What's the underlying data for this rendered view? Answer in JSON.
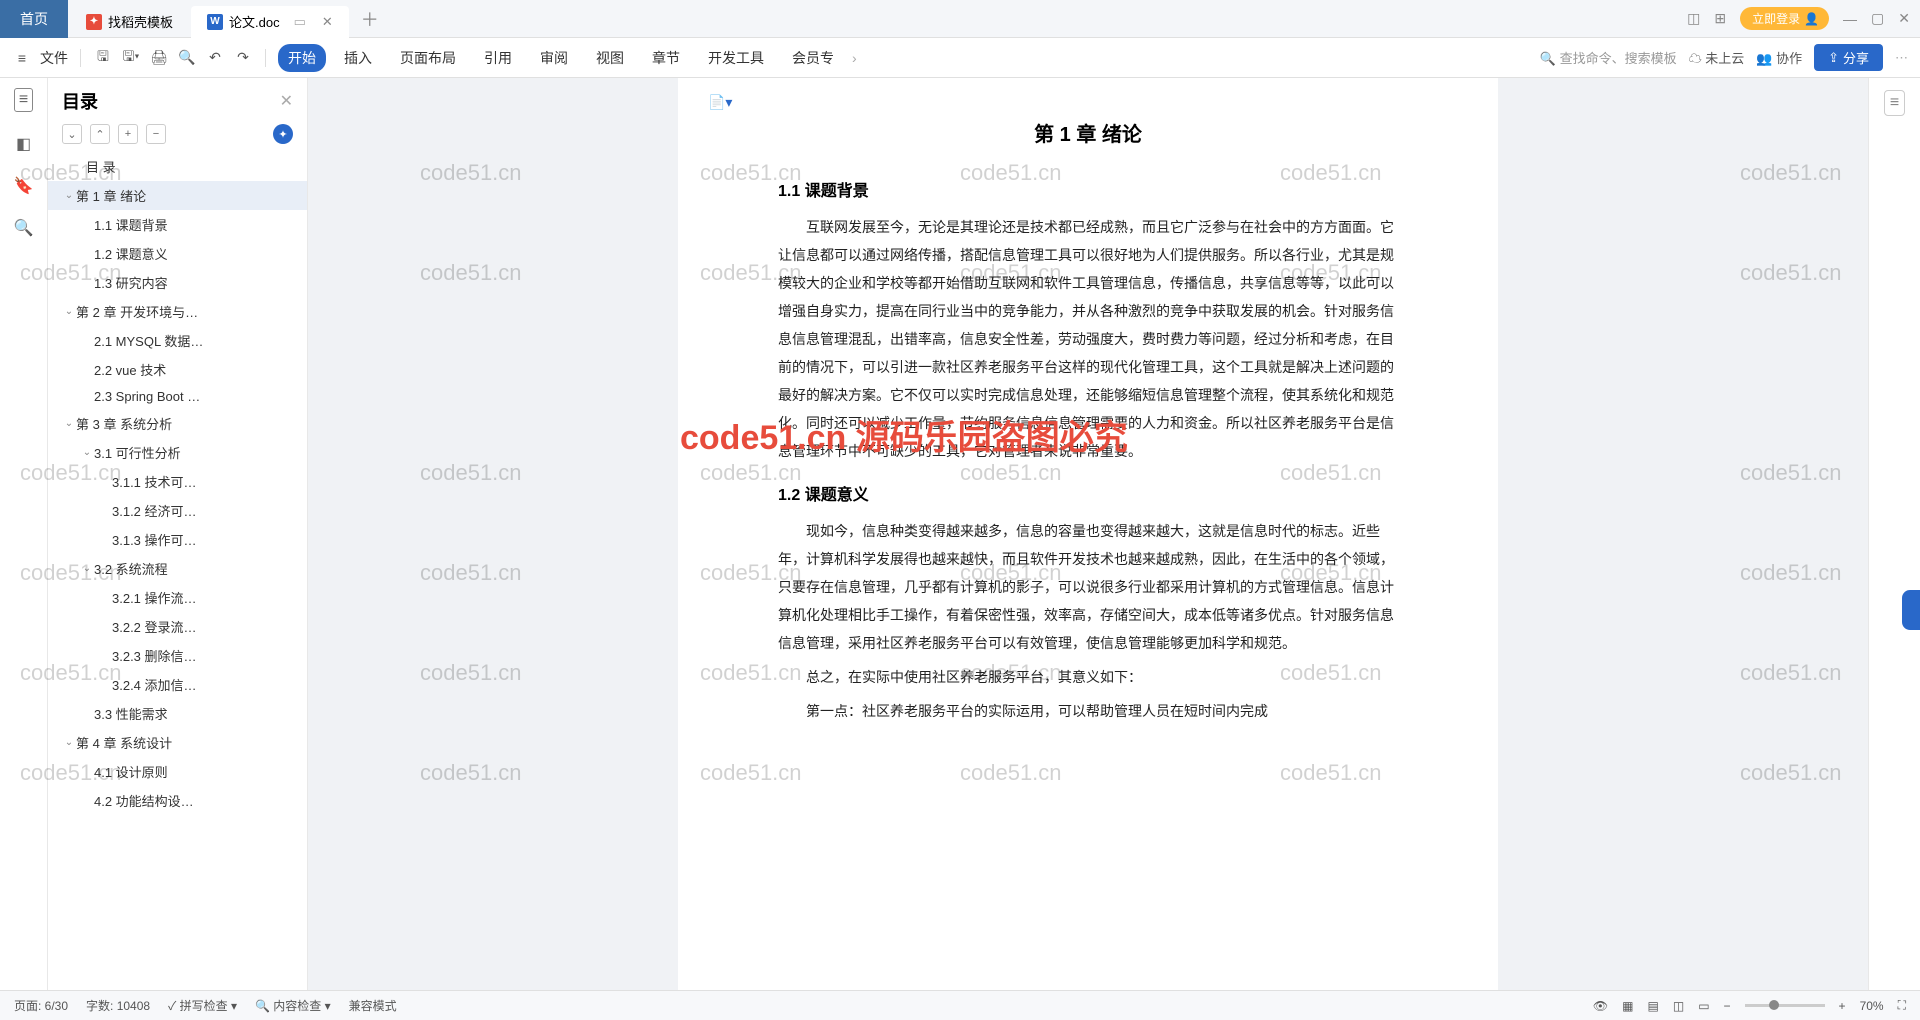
{
  "titlebar": {
    "home": "首页",
    "tabs": [
      {
        "icon": "W",
        "label": "找稻壳模板"
      },
      {
        "icon": "W",
        "label": "论文.doc"
      }
    ],
    "login": "立即登录"
  },
  "ribbon": {
    "fileLabel": "文件",
    "tabs": [
      "开始",
      "插入",
      "页面布局",
      "引用",
      "审阅",
      "视图",
      "章节",
      "开发工具",
      "会员专"
    ],
    "searchPlaceholder": "查找命令、搜索模板",
    "cloud": "未上云",
    "collab": "协作",
    "share": "分享"
  },
  "outline": {
    "title": "目录",
    "items": [
      {
        "l": 0,
        "t": "目  录"
      },
      {
        "l": 1,
        "t": "第 1 章  绪论",
        "chev": 1,
        "sel": 1
      },
      {
        "l": 2,
        "t": "1.1  课题背景"
      },
      {
        "l": 2,
        "t": "1.2  课题意义"
      },
      {
        "l": 2,
        "t": "1.3  研究内容"
      },
      {
        "l": 1,
        "t": "第 2 章  开发环境与…",
        "chev": 1
      },
      {
        "l": 2,
        "t": "2.1 MYSQL 数据…"
      },
      {
        "l": 2,
        "t": "2.2 vue 技术"
      },
      {
        "l": 2,
        "t": "2.3 Spring Boot …"
      },
      {
        "l": 1,
        "t": "第 3 章  系统分析",
        "chev": 1
      },
      {
        "l": 2,
        "t": "3.1  可行性分析",
        "chev": 1
      },
      {
        "l": 3,
        "t": "3.1.1  技术可…"
      },
      {
        "l": 3,
        "t": "3.1.2  经济可…"
      },
      {
        "l": 3,
        "t": "3.1.3  操作可…"
      },
      {
        "l": 2,
        "t": "3.2  系统流程",
        "chev": 1
      },
      {
        "l": 3,
        "t": "3.2.1  操作流…"
      },
      {
        "l": 3,
        "t": "3.2.2  登录流…"
      },
      {
        "l": 3,
        "t": "3.2.3  删除信…"
      },
      {
        "l": 3,
        "t": "3.2.4  添加信…"
      },
      {
        "l": 2,
        "t": "3.3  性能需求"
      },
      {
        "l": 1,
        "t": "第 4 章  系统设计",
        "chev": 1
      },
      {
        "l": 2,
        "t": "4.1  设计原则"
      },
      {
        "l": 2,
        "t": "4.2  功能结构设…"
      }
    ]
  },
  "doc": {
    "h1": "第 1 章  绪论",
    "s1": "1.1  课题背景",
    "p1": "互联网发展至今，无论是其理论还是技术都已经成熟，而且它广泛参与在社会中的方方面面。它让信息都可以通过网络传播，搭配信息管理工具可以很好地为人们提供服务。所以各行业，尤其是规模较大的企业和学校等都开始借助互联网和软件工具管理信息，传播信息，共享信息等等，以此可以增强自身实力，提高在同行业当中的竞争能力，并从各种激烈的竞争中获取发展的机会。针对服务信息信息管理混乱，出错率高，信息安全性差，劳动强度大，费时费力等问题，经过分析和考虑，在目前的情况下，可以引进一款社区养老服务平台这样的现代化管理工具，这个工具就是解决上述问题的最好的解决方案。它不仅可以实时完成信息处理，还能够缩短信息管理整个流程，使其系统化和规范化。同时还可以减少工作量，节约服务信息信息管理需要的人力和资金。所以社区养老服务平台是信息管理环节中不可缺少的工具，它对管理者来说非常重要。",
    "s2": "1.2  课题意义",
    "p2": "现如今，信息种类变得越来越多，信息的容量也变得越来越大，这就是信息时代的标志。近些年，计算机科学发展得也越来越快，而且软件开发技术也越来越成熟，因此，在生活中的各个领域，只要存在信息管理，几乎都有计算机的影子，可以说很多行业都采用计算机的方式管理信息。信息计算机化处理相比手工操作，有着保密性强，效率高，存储空间大，成本低等诸多优点。针对服务信息信息管理，采用社区养老服务平台可以有效管理，使信息管理能够更加科学和规范。",
    "p3": "总之，在实际中使用社区养老服务平台，其意义如下：",
    "p4": "第一点：社区养老服务平台的实际运用，可以帮助管理人员在短时间内完成"
  },
  "status": {
    "page": "页面: 6/30",
    "words": "字数: 10408",
    "spell": "拼写检查 ▾",
    "content": "内容检查 ▾",
    "compat": "兼容模式",
    "zoom": "70%"
  },
  "watermarkText": "code51.cn",
  "watermarkRed": "code51.cn  源码乐园盗图必究"
}
